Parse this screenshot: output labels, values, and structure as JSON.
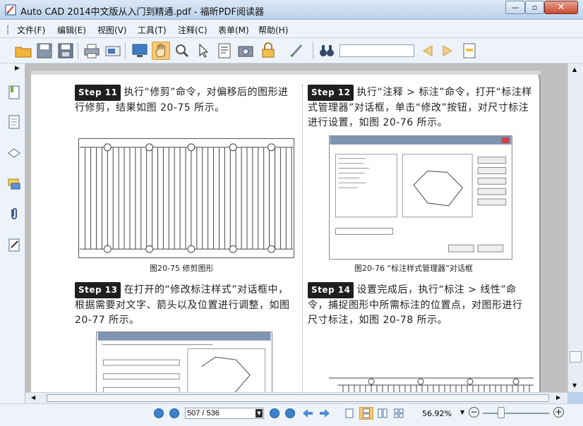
{
  "window": {
    "title": "Auto CAD 2014中文版从入门到精通.pdf - 福昕PDF阅读器",
    "min_glyph": "—",
    "max_glyph": "▫",
    "close_glyph": "✕"
  },
  "menu": [
    {
      "label": "文件(F)"
    },
    {
      "label": "编辑(E)"
    },
    {
      "label": "视图(V)"
    },
    {
      "label": "工具(T)"
    },
    {
      "label": "注释(C)"
    },
    {
      "label": "表单(M)"
    },
    {
      "label": "帮助(H)"
    }
  ],
  "toolbar": {
    "search_value": "",
    "icons": [
      "open-folder-icon",
      "save-icon",
      "save-as-icon",
      "print-icon",
      "scan-icon",
      "fullscreen-icon",
      "hand-tool-icon",
      "snapshot-zoom-icon",
      "select-arrow-icon",
      "text-select-icon",
      "camera-icon",
      "rms-lock-icon",
      "sign-icon",
      "binoculars-icon",
      "prev-result-icon",
      "next-result-icon",
      "highlight-icon"
    ]
  },
  "sidebar": {
    "toggle_glyph": "▶",
    "items": [
      "bookmarks-icon",
      "pages-icon",
      "layers-icon",
      "comments-icon",
      "attachments-icon",
      "signatures-icon"
    ]
  },
  "document": {
    "step11": {
      "badge": "Step 11",
      "text": "执行“修剪”命令，对偏移后的图形进行修剪，结果如图 20-75 所示。"
    },
    "step12": {
      "badge": "Step 12",
      "text": "执行“注释 > 标注”命令，打开“标注样式管理器”对话框，单击“修改”按钮，对尺寸标注进行设置，如图 20-76 所示。"
    },
    "step13": {
      "badge": "Step 13",
      "text": "在打开的“修改标注样式”对话框中，根据需要对文字、箭头以及位置进行调整，如图 20-77 所示。"
    },
    "step14": {
      "badge": "Step 14",
      "text": "设置完成后，执行“标注 > 线性”命令，捕捉图形中所需标注的位置点，对图形进行尺寸标注，如图 20-78 所示。"
    },
    "fig75_caption": "图20-75  修剪图形",
    "fig76_caption": "图20-76 “标注样式管理器”对话框"
  },
  "scroll": {
    "up": "▲",
    "down": "▼",
    "left": "◀",
    "right": "▶"
  },
  "status": {
    "page_value": "507 / 536",
    "zoom": "56.92%",
    "zoom_minus": "−",
    "zoom_plus": "+"
  },
  "colors": {
    "accent": "#3c82cc",
    "hand_active": "#f7c873"
  }
}
